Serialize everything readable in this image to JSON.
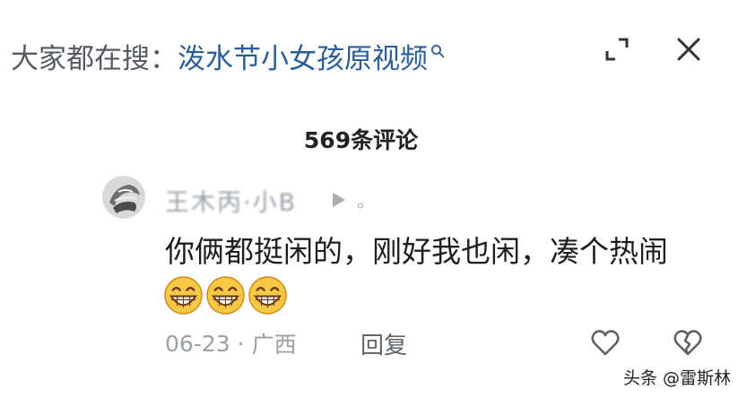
{
  "search_hint": {
    "prefix": "大家都在搜：",
    "query": "泼水节小女孩原视频",
    "search_icon": "search-icon"
  },
  "top_actions": {
    "expand_icon": "expand-icon",
    "close_icon": "close-icon"
  },
  "comments": {
    "count_label": "569条评论"
  },
  "comment": {
    "username": "王木丙·小B",
    "badge_mark": "。",
    "text": "你俩都挺闲的，刚好我也闲，凑个热闹",
    "emojis": [
      "grin-emoji",
      "grin-emoji",
      "grin-emoji"
    ],
    "date": "06-23",
    "separator": "·",
    "location": "广西",
    "reply_label": "回复",
    "like_icon": "heart-icon",
    "dislike_icon": "broken-heart-icon"
  },
  "watermark": "头条 @雷斯林",
  "colors": {
    "query_link": "#2a5d9b",
    "muted_text": "#9aa0a6",
    "icon_stroke": "#5f6368"
  }
}
